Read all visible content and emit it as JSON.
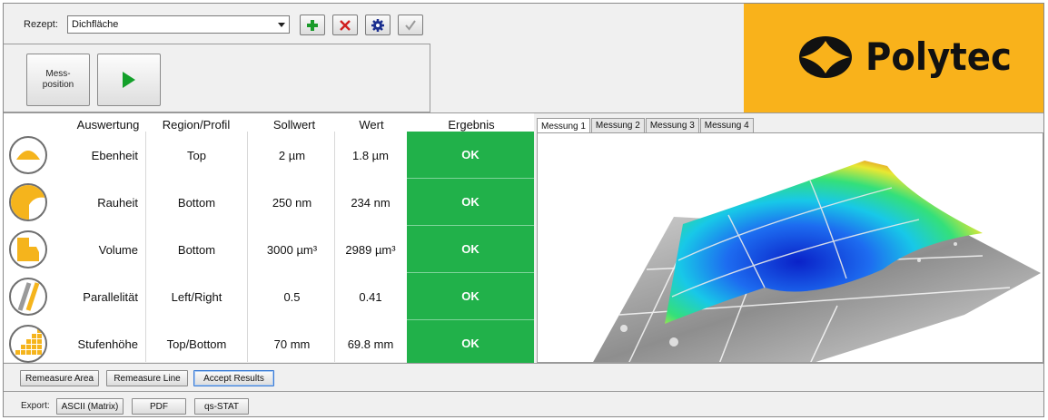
{
  "toolbar": {
    "recipe_label": "Rezept:",
    "recipe_value": "Dichfläche",
    "add_icon": "plus-icon",
    "delete_icon": "x-icon",
    "settings_icon": "gear-icon",
    "confirm_icon": "check-icon"
  },
  "measure": {
    "position_label_line1": "Mess-",
    "position_label_line2": "position",
    "start_icon": "play-icon"
  },
  "logo": {
    "text": "Polytec",
    "bg_color": "#f9b21b"
  },
  "table": {
    "headers": {
      "auswertung": "Auswertung",
      "region": "Region/Profil",
      "sollwert": "Sollwert",
      "wert": "Wert",
      "ergebnis": "Ergebnis"
    },
    "rows": [
      {
        "icon": "flatness-icon",
        "name": "Ebenheit",
        "region": "Top",
        "soll": "2 µm",
        "wert": "1.8 µm",
        "ergebnis": "OK"
      },
      {
        "icon": "roughness-icon",
        "name": "Rauheit",
        "region": "Bottom",
        "soll": "250 nm",
        "wert": "234 nm",
        "ergebnis": "OK"
      },
      {
        "icon": "volume-icon",
        "name": "Volume",
        "region": "Bottom",
        "soll": "3000 µm³",
        "wert": "2989 µm³",
        "ergebnis": "OK"
      },
      {
        "icon": "parallelism-icon",
        "name": "Parallelität",
        "region": "Left/Right",
        "soll": "0.5",
        "wert": "0.41",
        "ergebnis": "OK"
      },
      {
        "icon": "step-height-icon",
        "name": "Stufenhöhe",
        "region": "Top/Bottom",
        "soll": "70 mm",
        "wert": "69.8 mm",
        "ergebnis": "OK"
      }
    ],
    "ok_color": "#21b14a"
  },
  "tabs": [
    {
      "label": "Messung 1",
      "active": true
    },
    {
      "label": "Messung 2",
      "active": false
    },
    {
      "label": "Messung 3",
      "active": false
    },
    {
      "label": "Messung 4",
      "active": false
    }
  ],
  "actions": {
    "remeasure_area": "Remeasure Area",
    "remeasure_line": "Remeasure Line",
    "accept_results": "Accept Results"
  },
  "export": {
    "label": "Export:",
    "ascii": "ASCII (Matrix)",
    "pdf": "PDF",
    "qs_stat": "qs-STAT"
  }
}
